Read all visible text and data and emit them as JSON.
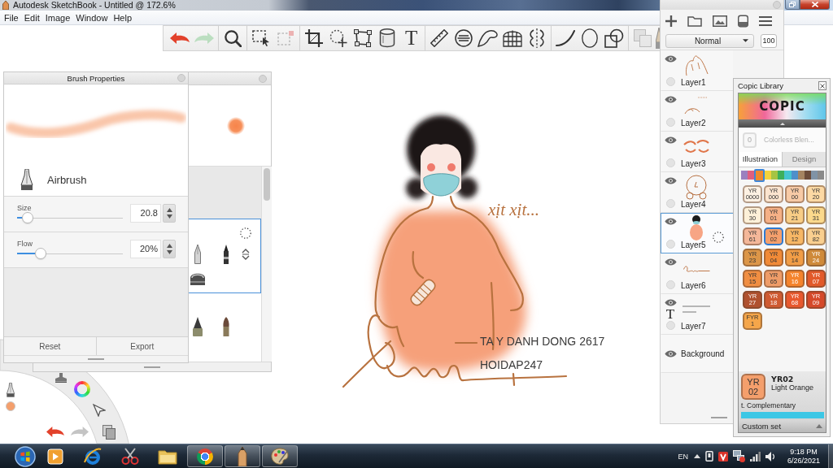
{
  "window": {
    "title": "Autodesk SketchBook - Untitled @ 172.6%"
  },
  "menu_bar": [
    "File",
    "Edit",
    "Image",
    "Window",
    "Help"
  ],
  "toolbar": {
    "tools": [
      {
        "kind": "undo",
        "disabled": false
      },
      {
        "kind": "redo",
        "disabled": true
      },
      {
        "kind": "separator"
      },
      {
        "kind": "zoom",
        "disabled": false
      },
      {
        "kind": "separator"
      },
      {
        "kind": "select",
        "disabled": false
      },
      {
        "kind": "mask",
        "disabled": true
      },
      {
        "kind": "separator"
      },
      {
        "kind": "crop",
        "disabled": false
      },
      {
        "kind": "lasso",
        "disabled": false
      },
      {
        "kind": "transform",
        "disabled": false
      },
      {
        "kind": "fill",
        "disabled": false
      },
      {
        "kind": "text",
        "glyph": "T",
        "disabled": false
      },
      {
        "kind": "separator"
      },
      {
        "kind": "ruler",
        "disabled": false
      },
      {
        "kind": "ellipse_guide",
        "disabled": false
      },
      {
        "kind": "french_curve",
        "disabled": false
      },
      {
        "kind": "perspective",
        "disabled": false
      },
      {
        "kind": "symmetry",
        "disabled": false
      },
      {
        "kind": "separator"
      },
      {
        "kind": "stroke",
        "disabled": false
      },
      {
        "kind": "ellipse",
        "disabled": false
      },
      {
        "kind": "shapes",
        "disabled": false
      },
      {
        "kind": "separator"
      },
      {
        "kind": "copy",
        "disabled": true
      },
      {
        "kind": "brush",
        "disabled": false
      }
    ]
  },
  "brush_properties": {
    "title": "Brush Properties",
    "brush": "Airbrush",
    "sliders": [
      {
        "label": "Size",
        "value": "20.8",
        "level": 0.1
      },
      {
        "label": "Flow",
        "value": "20%",
        "level": 0.22
      }
    ],
    "buttons": [
      "Reset",
      "Export"
    ]
  },
  "canvas": {
    "handwriting": "xịt xịt...",
    "text_layer": [
      "TA Y DANH DONG 2617",
      "HOIDAP247"
    ]
  },
  "layers": {
    "blend_mode": "Normal",
    "opacity": "100",
    "items": [
      {
        "kind": "paint",
        "name": "Layer1",
        "visible": true,
        "selected": false
      },
      {
        "kind": "paint",
        "name": "Layer2",
        "visible": true,
        "selected": false
      },
      {
        "kind": "paint",
        "name": "Layer3",
        "visible": true,
        "selected": false
      },
      {
        "kind": "paint",
        "name": "Layer4",
        "visible": true,
        "selected": false
      },
      {
        "kind": "paint",
        "name": "Layer5",
        "visible": true,
        "selected": true
      },
      {
        "kind": "paint",
        "name": "Layer6",
        "visible": true,
        "selected": false
      },
      {
        "kind": "text",
        "glyph": "T",
        "name": "Layer7",
        "visible": true,
        "selected": false
      },
      {
        "kind": "background",
        "name": "Background",
        "visible": true,
        "selected": false
      }
    ]
  },
  "copic_library": {
    "title": "Copic Library",
    "logo": "COPIC",
    "blender": {
      "code": "0",
      "name": "Colorless Blen..."
    },
    "tabs": [
      {
        "label": "Illustration",
        "selected": true
      },
      {
        "label": "Design",
        "selected": false
      }
    ],
    "families": [
      {
        "color": "#9b80bf",
        "selected": false
      },
      {
        "color": "#e05f7f",
        "selected": false
      },
      {
        "color": "#f08a2c",
        "selected": true
      },
      {
        "color": "#f3d23c",
        "selected": false
      },
      {
        "color": "#a6c443",
        "selected": false
      },
      {
        "color": "#3daf5b",
        "selected": false
      },
      {
        "color": "#44c5d0",
        "selected": false
      },
      {
        "color": "#4f8fca",
        "selected": false
      },
      {
        "color": "#a58461",
        "selected": false
      },
      {
        "color": "#6c4c3a",
        "selected": false
      },
      {
        "color": "#8093a6",
        "selected": false
      },
      {
        "color": "#8a8a8a",
        "selected": false
      }
    ],
    "swatches": [
      {
        "family": "YR",
        "code": "0000",
        "color": "#fdf1e3",
        "selected": false
      },
      {
        "family": "YR",
        "code": "000",
        "color": "#fbe4cf",
        "selected": false
      },
      {
        "family": "YR",
        "code": "00",
        "color": "#f7caa6",
        "selected": false
      },
      {
        "family": "YR",
        "code": "20",
        "color": "#fcd9a4",
        "selected": false
      },
      {
        "family": "YR",
        "code": "30",
        "color": "#fdf0d8",
        "selected": false
      },
      {
        "family": "YR",
        "code": "01",
        "color": "#f5b086",
        "selected": false
      },
      {
        "family": "YR",
        "code": "21",
        "color": "#f8cd86",
        "selected": false
      },
      {
        "family": "YR",
        "code": "31",
        "color": "#fbd98c",
        "selected": false
      },
      {
        "family": "YR",
        "code": "61",
        "color": "#f4b799",
        "selected": false
      },
      {
        "family": "YR",
        "code": "02",
        "color": "#f49f6c",
        "selected": true
      },
      {
        "family": "YR",
        "code": "12",
        "color": "#f7b765",
        "selected": false
      },
      {
        "family": "YR",
        "code": "82",
        "color": "#f9cf8f",
        "selected": false
      },
      {
        "family": "YR",
        "code": "23",
        "color": "#dc9648",
        "selected": false
      },
      {
        "family": "YR",
        "code": "04",
        "color": "#f18a37",
        "selected": false
      },
      {
        "family": "YR",
        "code": "14",
        "color": "#f19d46",
        "selected": false
      },
      {
        "family": "YR",
        "code": "24",
        "color": "#cf8a3a",
        "selected": false
      },
      {
        "family": "YR",
        "code": "15",
        "color": "#f08e42",
        "selected": false
      },
      {
        "family": "YR",
        "code": "65",
        "color": "#ee9c68",
        "selected": false
      },
      {
        "family": "YR",
        "code": "16",
        "color": "#f5842c",
        "selected": false
      },
      {
        "family": "YR",
        "code": "07",
        "color": "#e25a2a",
        "selected": false
      },
      {
        "family": "YR",
        "code": "27",
        "color": "#b0512f",
        "selected": false
      },
      {
        "family": "YR",
        "code": "18",
        "color": "#cf5a32",
        "selected": false
      },
      {
        "family": "YR",
        "code": "68",
        "color": "#e8582e",
        "selected": false
      },
      {
        "family": "YR",
        "code": "09",
        "color": "#d5492a",
        "selected": false
      },
      {
        "family": "FYR",
        "code": "1",
        "color": "#f5a64a",
        "selected": false
      }
    ],
    "current": {
      "family": "YR",
      "code": "02",
      "title": "YR02",
      "name": "Light Orange",
      "complementary": "t. Complementary"
    },
    "custom_set": "Custom set"
  },
  "taskbar": {
    "apps": [
      {
        "kind": "media",
        "running": false
      },
      {
        "kind": "browser",
        "running": false
      },
      {
        "kind": "snipping",
        "running": false
      },
      {
        "kind": "explorer",
        "running": false
      },
      {
        "kind": "chrome",
        "running": true
      },
      {
        "kind": "sketch",
        "running": true
      },
      {
        "kind": "paint",
        "running": true
      }
    ],
    "language": "EN",
    "time": "9:18 PM",
    "date": "6/26/2021"
  }
}
